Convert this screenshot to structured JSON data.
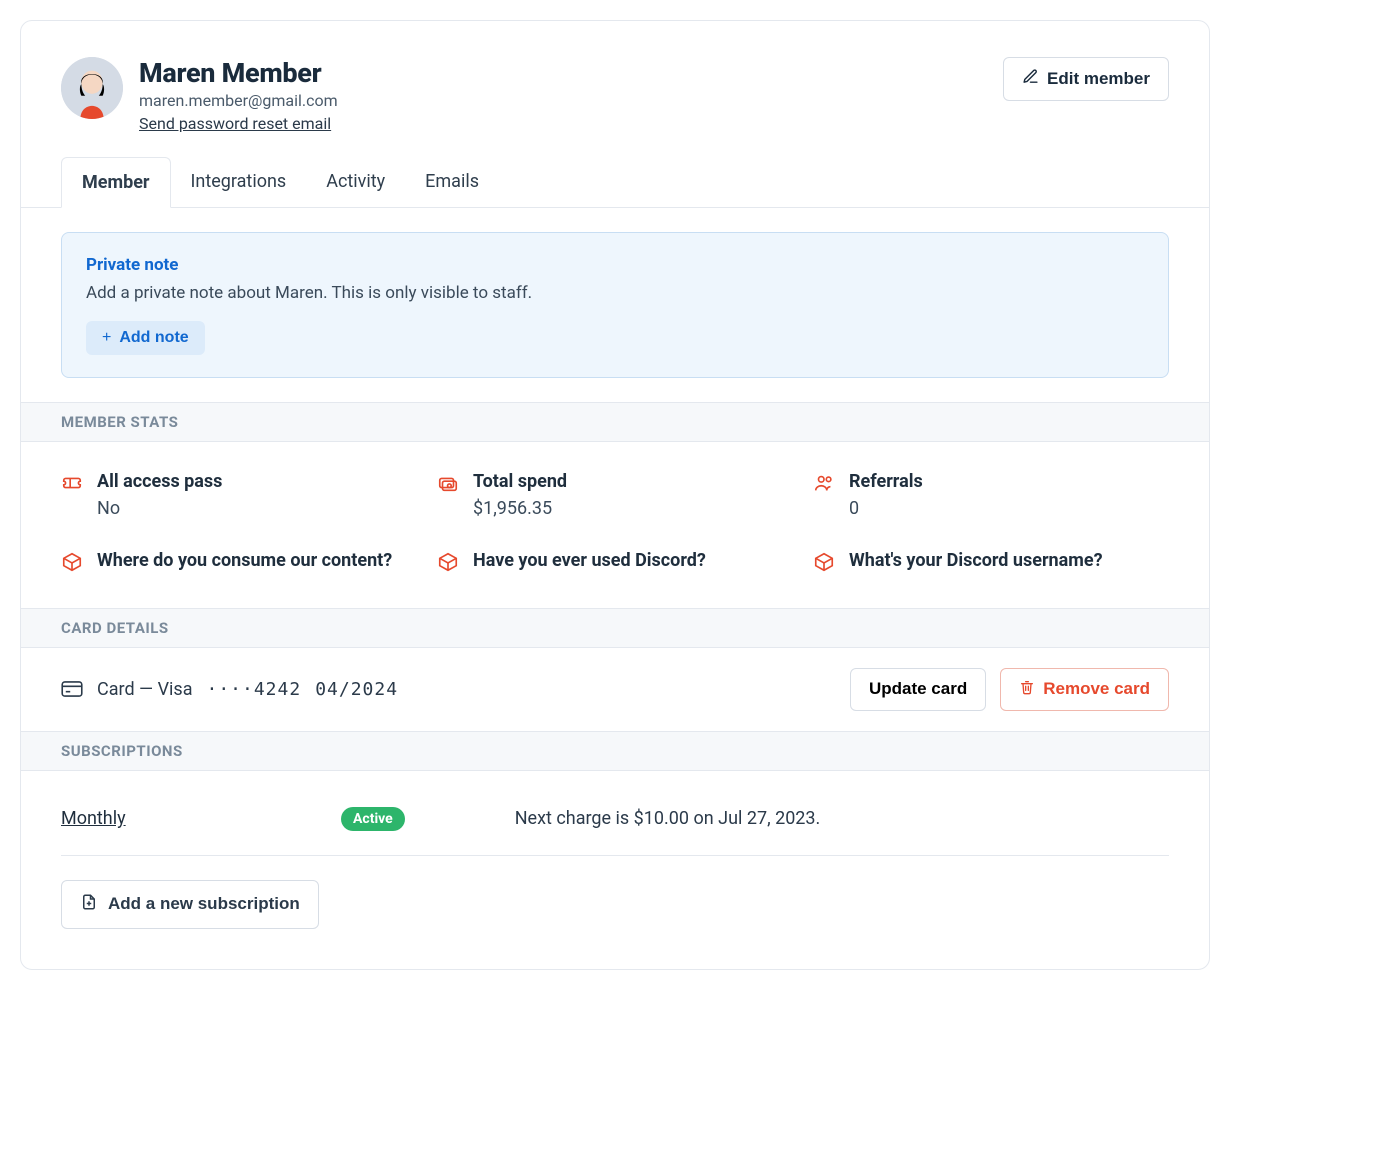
{
  "member": {
    "name": "Maren Member",
    "email": "maren.member@gmail.com",
    "reset_link": "Send password reset email"
  },
  "actions": {
    "edit_member": "Edit member"
  },
  "tabs": {
    "member": "Member",
    "integrations": "Integrations",
    "activity": "Activity",
    "emails": "Emails"
  },
  "note": {
    "title": "Private note",
    "description": "Add a private note about Maren. This is only visible to staff.",
    "add_button": "Add note"
  },
  "sections": {
    "member_stats": "MEMBER STATS",
    "card_details": "CARD DETAILS",
    "subscriptions": "SUBSCRIPTIONS"
  },
  "stats": {
    "all_access_label": "All access pass",
    "all_access_value": "No",
    "total_spend_label": "Total spend",
    "total_spend_value": "$1,956.35",
    "referrals_label": "Referrals",
    "referrals_value": "0",
    "q1_label": "Where do you consume our content?",
    "q2_label": "Have you ever used Discord?",
    "q3_label": "What's your Discord username?"
  },
  "card": {
    "text_prefix": "Card — Visa",
    "masked": "····4242",
    "expiry": "04/2024",
    "update": "Update card",
    "remove": "Remove card"
  },
  "subscription": {
    "plan": "Monthly",
    "status": "Active",
    "next_charge": "Next charge is $10.00 on  Jul 27, 2023.",
    "add_new": "Add a new subscription"
  }
}
